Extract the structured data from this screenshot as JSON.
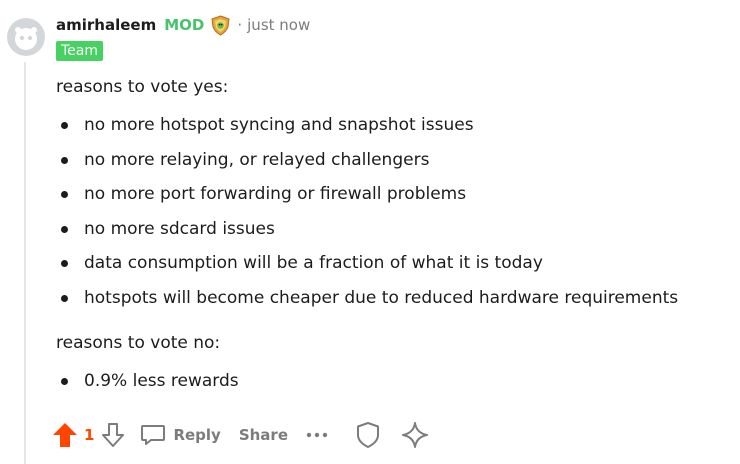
{
  "comment": {
    "author": "amirhaleem",
    "mod_label": "MOD",
    "separator": "·",
    "time": "just now",
    "flair": "Team",
    "badge_icon": "shield-badge-icon",
    "colors": {
      "mod": "#46c36b",
      "flair_bg": "#46d160",
      "upvote": "#ff4500",
      "muted": "#7c7c7c"
    },
    "body": {
      "yes_heading": "reasons to vote yes:",
      "yes_points": [
        "no more hotspot syncing and snapshot issues",
        "no more relaying, or relayed challengers",
        "no more port forwarding or firewall problems",
        "no more sdcard issues",
        "data consumption will be a fraction of what it is today",
        "hotspots will become cheaper due to reduced hardware requirements"
      ],
      "no_heading": "reasons to vote no:",
      "no_points": [
        "0.9% less rewards"
      ]
    },
    "actions": {
      "score": "1",
      "reply_label": "Reply",
      "share_label": "Share",
      "more_icon": "more-dots-icon",
      "save_icon": "shield-icon",
      "award_icon": "sparkle-icon"
    }
  }
}
